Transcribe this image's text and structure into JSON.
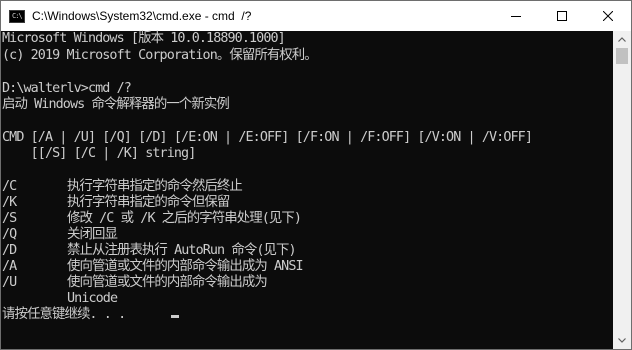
{
  "window": {
    "title": "C:\\Windows\\System32\\cmd.exe - cmd  /?",
    "icon": "cmd-app-icon",
    "icon_text": "C:\\",
    "controls": [
      "minimize-icon",
      "maximize-icon",
      "close-icon"
    ]
  },
  "console": {
    "text_color": "#cccccc",
    "background": "#0c0c0c",
    "header": [
      "Microsoft Windows [版本 10.0.18890.1000]",
      "(c) 2019 Microsoft Corporation。保留所有权利。"
    ],
    "prompt": "D:\\walterlv>cmd /?",
    "description": "启动 Windows 命令解释器的一个新实例",
    "usage": [
      "CMD [/A | /U] [/Q] [/D] [/E:ON | /E:OFF] [/F:ON | /F:OFF] [/V:ON | /V:OFF]",
      "    [[/S] [/C | /K] string]"
    ],
    "options": [
      {
        "flag": "/C",
        "desc": "执行字符串指定的命令然后终止"
      },
      {
        "flag": "/K",
        "desc": "执行字符串指定的命令但保留"
      },
      {
        "flag": "/S",
        "desc": "修改 /C 或 /K 之后的字符串处理(见下)"
      },
      {
        "flag": "/Q",
        "desc": "关闭回显"
      },
      {
        "flag": "/D",
        "desc": "禁止从注册表执行 AutoRun 命令(见下)"
      },
      {
        "flag": "/A",
        "desc": "使向管道或文件的内部命令输出成为 ANSI"
      },
      {
        "flag": "/U",
        "desc": "使向管道或文件的内部命令输出成为"
      },
      {
        "flag": "",
        "desc": "Unicode"
      }
    ],
    "pause_prompt": "请按任意键继续. . ."
  }
}
